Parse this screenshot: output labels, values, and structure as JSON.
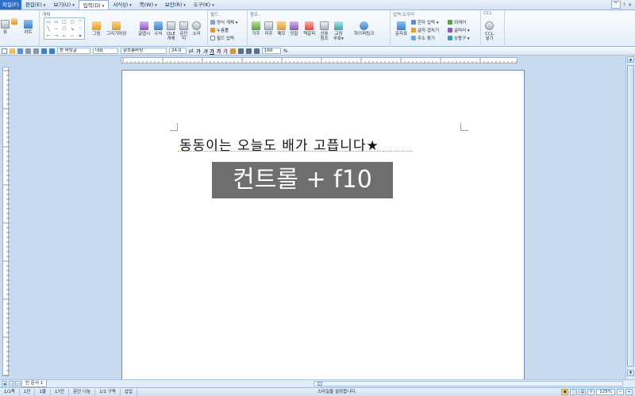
{
  "menubar": {
    "items": [
      "파일(F)",
      "편집(E)",
      "보기(U)",
      "입력(D)",
      "서식(J)",
      "쪽(W)",
      "보안(R)",
      "도구(K)"
    ],
    "active_index": 3,
    "window_controls": [
      "^",
      "?",
      "×"
    ]
  },
  "ribbon": {
    "chart_label": "차트",
    "table_prefix": "표",
    "groups": {
      "shapes_title": "개체",
      "field_title": "필드",
      "reference_title": "참조",
      "input_tools_title": "입력 도우미",
      "ccl_title": "CCL"
    },
    "object_buttons": [
      "그림",
      "그리기마당",
      "글맵시",
      "수식",
      "OLE\n개체",
      "문단\n띠",
      "소리"
    ],
    "field_items": [
      "양식 개체 ▾",
      "누름틀",
      "필드 입력"
    ],
    "reference_buttons": [
      "각주",
      "미주",
      "메모",
      "덧말",
      "책갈피",
      "상호\n참조",
      "교정\n부호▾"
    ],
    "hyperlink_label": "하이퍼링크",
    "input_tool_button": "문자표",
    "input_tool_items": [
      "한자 입력 ▾",
      "글자 겹치기",
      "주소 찾기",
      "외래어",
      "글머리 ▾",
      "상용구 ▾"
    ],
    "ccl_button": "CCL\n넣기"
  },
  "toolbar": {
    "style_combo": "본 바탕글",
    "lang_combo": "대표",
    "font_combo": "함초롬바탕",
    "size_combo": "24.0",
    "size_unit": "pt",
    "format_buttons": [
      "가",
      "가",
      "가",
      "가",
      "가"
    ],
    "zoom_combo": "160",
    "zoom_unit": "%"
  },
  "document": {
    "line_text": "동동이는 오늘도 배가 고픕니다★",
    "overlay_text": "컨트롤 + f10"
  },
  "tabs": {
    "doc_tab": "빈 문서 1"
  },
  "statusbar": {
    "items": [
      "1/1쪽",
      "1단",
      "1줄",
      "17칸",
      "문단 나눔",
      "1/1 구역",
      "삽입"
    ],
    "message": "스타일을 설정합니다.",
    "zoom": "125%"
  }
}
